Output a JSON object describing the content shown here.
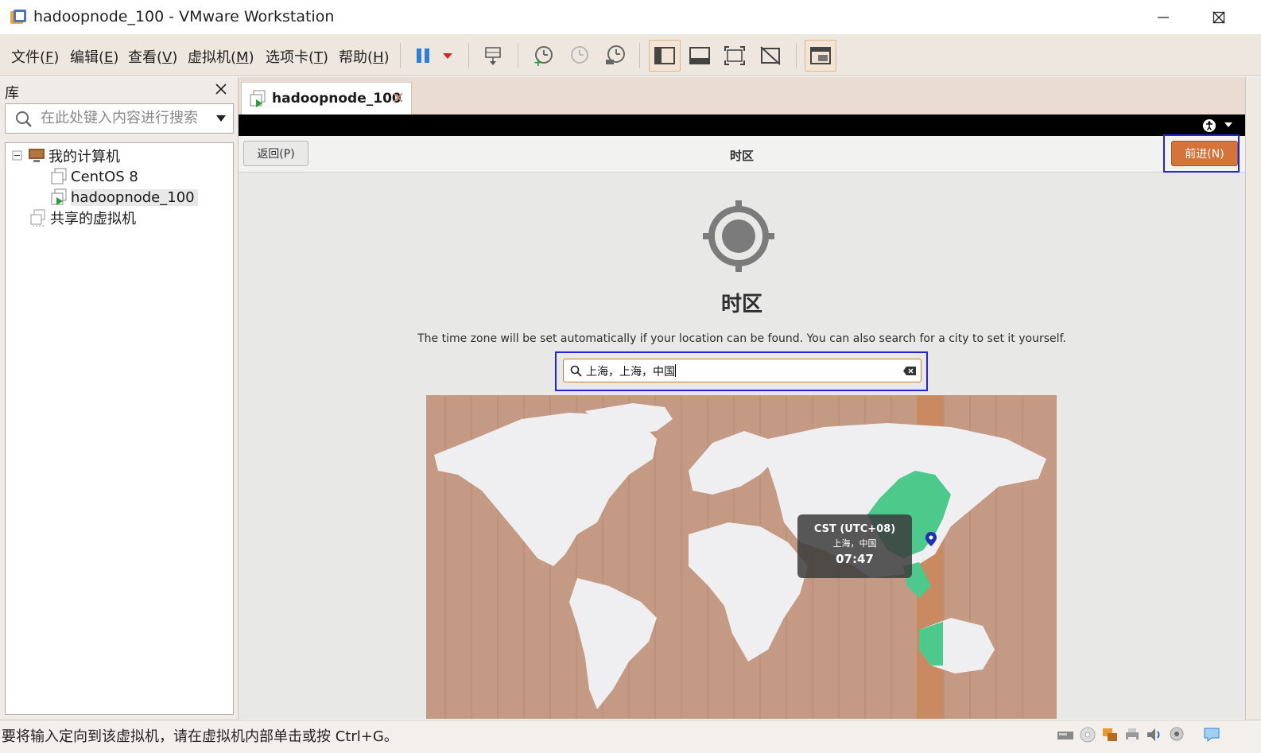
{
  "window": {
    "title": "hadoopnode_100 - VMware Workstation"
  },
  "menu": [
    {
      "label": "文件(",
      "key": "F",
      "suffix": ")"
    },
    {
      "label": "编辑(",
      "key": "E",
      "suffix": ")"
    },
    {
      "label": "查看(",
      "key": "V",
      "suffix": ")"
    },
    {
      "label": "虚拟机(",
      "key": "M",
      "suffix": ")"
    },
    {
      "label": "选项卡(",
      "key": "T",
      "suffix": ")"
    },
    {
      "label": "帮助(",
      "key": "H",
      "suffix": ")"
    }
  ],
  "library": {
    "title": "库",
    "search_placeholder": "在此处键入内容进行搜索",
    "tree": {
      "my_computer": "我的计算机",
      "vm1": "CentOS 8",
      "vm2": "hadoopnode_100",
      "shared": "共享的虚拟机"
    }
  },
  "tab": {
    "label": "hadoopnode_100"
  },
  "installer": {
    "back_label": "返回(P)",
    "header_title": "时区",
    "next_label": "前进(N)",
    "page_title": "时区",
    "description": "The time zone will be set automatically if your location can be found. You can also search for a city to set it yourself.",
    "search_value": "上海，上海，中国",
    "tooltip": {
      "zone": "CST (UTC+08)",
      "place": "上海，中国",
      "time": "07:47"
    }
  },
  "status": {
    "text": "要将输入定向到该虚拟机，请在虚拟机内部单击或按 Ctrl+G。"
  },
  "colors": {
    "accent_orange": "#d4733a",
    "focus_blue": "#2323e6",
    "map_ocean": "#c49a84",
    "map_land": "#efeef0",
    "map_selected": "#4cc98b"
  }
}
